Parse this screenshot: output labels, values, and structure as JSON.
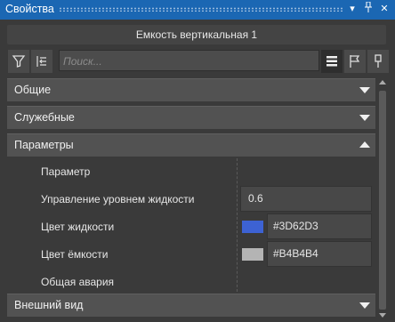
{
  "window": {
    "title": "Свойства"
  },
  "object": {
    "name": "Емкость вертикальная 1"
  },
  "search": {
    "placeholder": "Поиск..."
  },
  "groups": [
    {
      "label": "Общие",
      "expanded": false
    },
    {
      "label": "Служебные",
      "expanded": false
    },
    {
      "label": "Параметры",
      "expanded": true
    },
    {
      "label": "Внешний вид",
      "expanded": false
    }
  ],
  "params": {
    "header": "Параметр",
    "rows": [
      {
        "name": "Управление уровнем жидкости",
        "value": "0.6"
      },
      {
        "name": "Цвет жидкости",
        "value": "#3D62D3",
        "color": "#3D62D3"
      },
      {
        "name": "Цвет ёмкости",
        "value": "#B4B4B4",
        "color": "#B4B4B4"
      },
      {
        "name": "Общая авария"
      }
    ]
  },
  "colors": {
    "titlebar": "#1B67B3",
    "panel": "#3A3A3A",
    "group": "#525252"
  },
  "icons": [
    "filter-icon",
    "collapse-icon",
    "list-view-icon",
    "flag-icon",
    "pin-icon",
    "dropdown-icon",
    "close-icon"
  ]
}
